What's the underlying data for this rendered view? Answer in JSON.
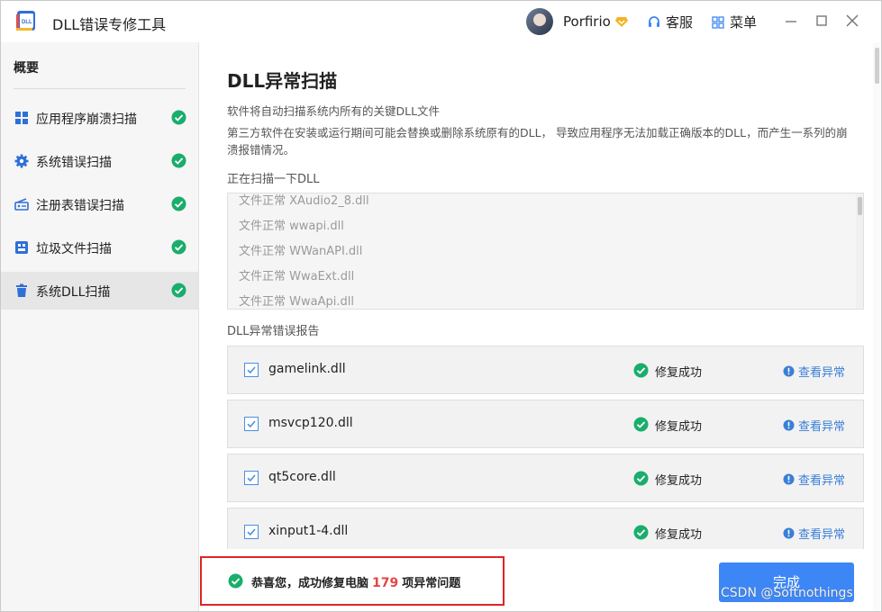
{
  "app": {
    "title": "DLL错误专修工具"
  },
  "header": {
    "username": "Porfirio",
    "service_label": "客服",
    "menu_label": "菜单"
  },
  "sidebar": {
    "title": "概要",
    "items": [
      {
        "label": "应用程序崩溃扫描",
        "icon": "grid-icon"
      },
      {
        "label": "系统错误扫描",
        "icon": "gear-icon"
      },
      {
        "label": "注册表错误扫描",
        "icon": "registry-icon"
      },
      {
        "label": "垃圾文件扫描",
        "icon": "junk-icon"
      },
      {
        "label": "系统DLL扫描",
        "icon": "trash-icon",
        "active": true
      }
    ]
  },
  "main": {
    "title": "DLL异常扫描",
    "desc1": "软件将自动扫描系统内所有的关键DLL文件",
    "desc2": "第三方软件在安装或运行期间可能会替换或删除系统原有的DLL， 导致应用程序无法加载正确版本的DLL，而产生一系列的崩溃报错情况。",
    "scan_label": "正在扫描一下DLL",
    "scan_lines": [
      "文件正常 XAudio2_8.dll",
      "文件正常 wwapi.dll",
      "文件正常 WWanAPI.dll",
      "文件正常 WwaExt.dll",
      "文件正常 WwaApi.dll"
    ],
    "report_label": "DLL异常错误报告",
    "report_rows": [
      {
        "file": "gamelink.dll",
        "status": "修复成功",
        "action": "查看异常"
      },
      {
        "file": "msvcp120.dll",
        "status": "修复成功",
        "action": "查看异常"
      },
      {
        "file": "qt5core.dll",
        "status": "修复成功",
        "action": "查看异常"
      },
      {
        "file": "xinput1-4.dll",
        "status": "修复成功",
        "action": "查看异常"
      }
    ]
  },
  "footer": {
    "msg_prefix": "恭喜您，成功修复电脑",
    "count": "179",
    "msg_suffix": "项异常问题",
    "done_label": "完成",
    "watermark": "CSDN @Softnothings"
  },
  "colors": {
    "accent": "#3d86f5",
    "success": "#1aad6c",
    "link": "#3a7fd6",
    "highlight": "#e54545",
    "annotation_border": "#e02424"
  }
}
